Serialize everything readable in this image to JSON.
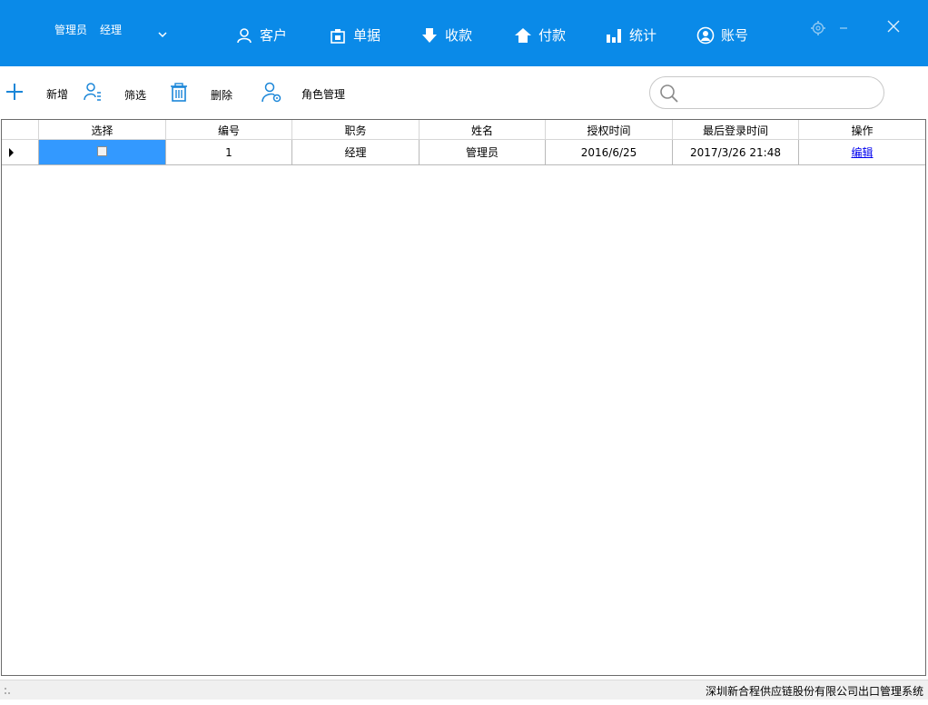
{
  "colors": {
    "topbar_bg": "#0a8ae8",
    "accent_icon": "#1a86d8",
    "selected_cell": "#3399ff",
    "link": "#0000ee"
  },
  "user": {
    "name": "管理员",
    "role": "经理"
  },
  "nav": [
    {
      "label": "客户",
      "icon": "person-outline-icon"
    },
    {
      "label": "单据",
      "icon": "document-clipboard-icon"
    },
    {
      "label": "收款",
      "icon": "download-arrow-icon"
    },
    {
      "label": "付款",
      "icon": "upload-home-icon"
    },
    {
      "label": "统计",
      "icon": "bar-chart-icon"
    },
    {
      "label": "账号",
      "icon": "account-circle-icon"
    }
  ],
  "toolbar": {
    "add_label": "新增",
    "filter_label": "筛选",
    "delete_label": "删除",
    "role_label": "角色管理",
    "search_placeholder": "",
    "search_value": ""
  },
  "table": {
    "columns": [
      "选择",
      "编号",
      "职务",
      "姓名",
      "授权时间",
      "最后登录时间",
      "操作"
    ],
    "rows": [
      {
        "checked": false,
        "id": "1",
        "position": "经理",
        "name": "管理员",
        "auth_date": "2016/6/25",
        "last_login": "2017/3/26 21:48",
        "action": "编辑"
      }
    ]
  },
  "status": {
    "text": "深圳新合程供应链股份有限公司出口管理系统"
  }
}
